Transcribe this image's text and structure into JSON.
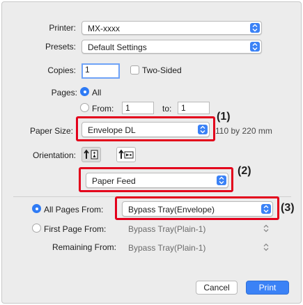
{
  "printer": {
    "label": "Printer:",
    "value": "MX-xxxx"
  },
  "presets": {
    "label": "Presets:",
    "value": "Default Settings"
  },
  "copies": {
    "label": "Copies:",
    "value": "1",
    "two_sided_label": "Two-Sided"
  },
  "pages": {
    "label": "Pages:",
    "all_label": "All",
    "from_label": "From:",
    "from_value": "1",
    "to_label": "to:",
    "to_value": "1"
  },
  "paper_size": {
    "label": "Paper Size:",
    "value": "Envelope DL",
    "dimension_text": "110 by 220 mm"
  },
  "orientation": {
    "label": "Orientation:"
  },
  "panel": {
    "value": "Paper Feed"
  },
  "paper_feed": {
    "all_pages_label": "All Pages From:",
    "all_pages_value": "Bypass Tray(Envelope)",
    "first_page_label": "First Page From:",
    "first_page_value": "Bypass Tray(Plain-1)",
    "remaining_label": "Remaining From:",
    "remaining_value": "Bypass Tray(Plain-1)"
  },
  "callouts": {
    "one": "(1)",
    "two": "(2)",
    "three": "(3)"
  },
  "buttons": {
    "cancel": "Cancel",
    "print": "Print"
  },
  "colors": {
    "accent": "#3b82f6",
    "highlight": "#e3001b",
    "dialog_bg": "#ececec"
  }
}
